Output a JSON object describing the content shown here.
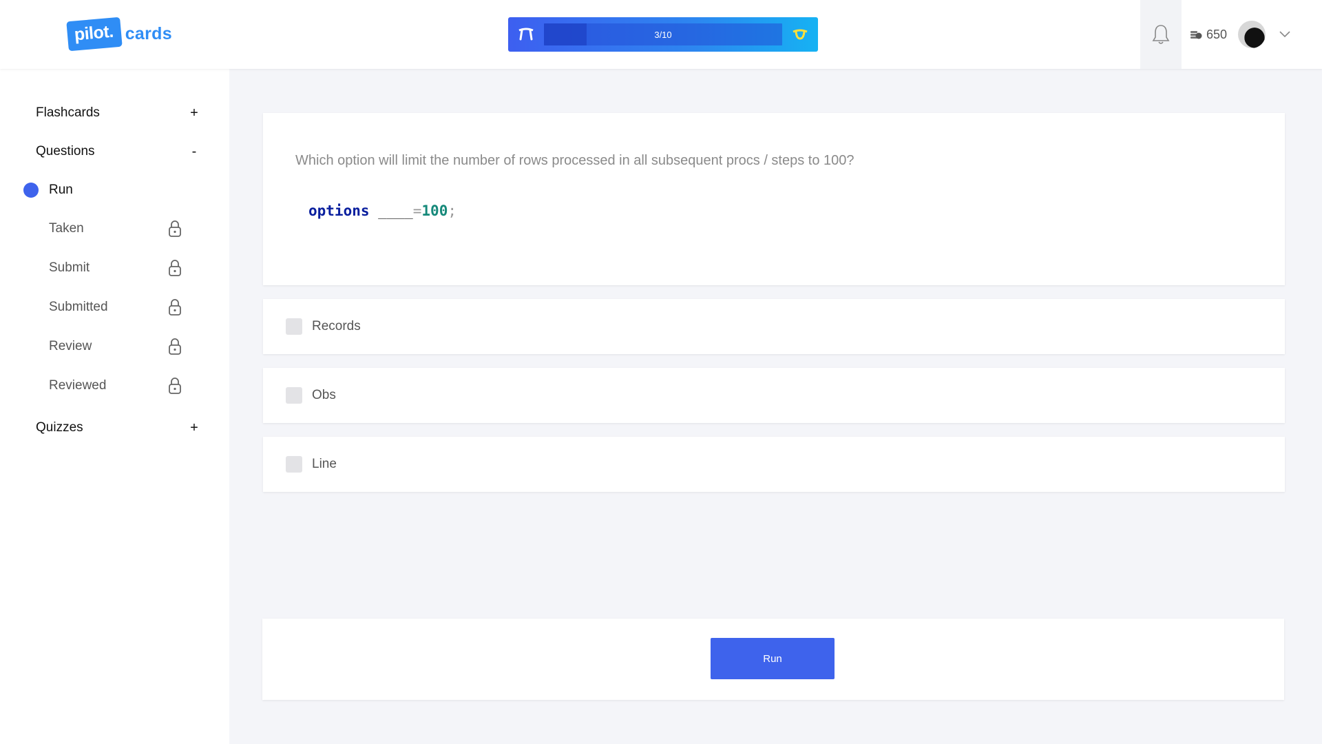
{
  "brand": {
    "badge": "pilot.",
    "name": "cards"
  },
  "progress": {
    "label": "3/10",
    "fraction": 0.18
  },
  "header": {
    "coins": "650"
  },
  "sidebar": {
    "flashcards": {
      "label": "Flashcards",
      "toggle": "+"
    },
    "questions": {
      "label": "Questions",
      "toggle": "-",
      "active": "Run",
      "items": [
        {
          "label": "Taken",
          "locked": true
        },
        {
          "label": "Submit",
          "locked": true
        },
        {
          "label": "Submitted",
          "locked": true
        },
        {
          "label": "Review",
          "locked": true
        },
        {
          "label": "Reviewed",
          "locked": true
        }
      ]
    },
    "quizzes": {
      "label": "Quizzes",
      "toggle": "+"
    }
  },
  "question": {
    "text": "Which option will limit the number of rows processed in all subsequent procs / steps to 100?",
    "code": {
      "keyword": "options",
      "blank": "____",
      "equals": "=",
      "value": "100",
      "end": ";"
    }
  },
  "options": [
    {
      "label": "Records",
      "checked": false
    },
    {
      "label": "Obs",
      "checked": false
    },
    {
      "label": "Line",
      "checked": false
    }
  ],
  "actions": {
    "run_label": "Run"
  },
  "colors": {
    "accent": "#3e63ec",
    "brand": "#2f8df5",
    "icon_yellow": "#ffe03a"
  }
}
